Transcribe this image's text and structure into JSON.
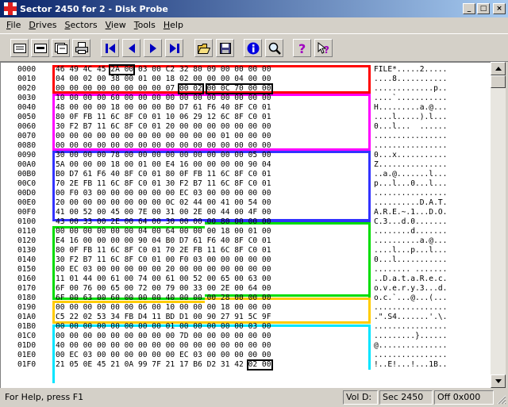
{
  "window": {
    "title": "Sector 2450 for 2 - Disk Probe",
    "minimize_glyph": "_",
    "maximize_glyph": "□",
    "close_glyph": "×"
  },
  "menu": [
    {
      "key": "F",
      "rest": "ile"
    },
    {
      "key": "D",
      "rest": "rives"
    },
    {
      "key": "S",
      "rest": "ectors"
    },
    {
      "key": "V",
      "rest": "iew"
    },
    {
      "key": "T",
      "rest": "ools"
    },
    {
      "key": "H",
      "rest": "elp"
    }
  ],
  "toolbar": {
    "icons": [
      "view-bytes-icon",
      "view-words-icon",
      "view-dwords-icon",
      "print-icon",
      "first-sector-icon",
      "previous-sector-icon",
      "next-sector-icon",
      "last-sector-icon",
      "open-icon",
      "save-icon",
      "info-icon",
      "find-icon",
      "help-icon",
      "context-help-icon"
    ]
  },
  "zone_colors": {
    "red": "#ff0000",
    "magenta": "#ff00ff",
    "blue": "#3333ff",
    "green": "#00dd00",
    "yellow": "#ffcc00",
    "cyan": "#00e5ff"
  },
  "dump": [
    {
      "offset": "0000",
      "hex": "46 49 4C 45 2A 00 03 00 C2 32 80 09 00 00 00 00",
      "ascii": "FILE*.....2....."
    },
    {
      "offset": "0010",
      "hex": "04 00 02 00 38 00 01 00 18 02 00 00 00 04 00 00",
      "ascii": "....8..........."
    },
    {
      "offset": "0020",
      "hex": "00 00 00 00 00 00 00 00 07 00 02 00 0C 70 00 00",
      "ascii": ".............p.."
    },
    {
      "offset": "0030",
      "hex": "10 00 00 00 60 00 00 00 00 00 00 00 00 00 00 00",
      "ascii": "....`..........."
    },
    {
      "offset": "0040",
      "hex": "48 00 00 00 18 00 00 00 B0 D7 61 F6 40 8F C0 01",
      "ascii": "H.........a.@..."
    },
    {
      "offset": "0050",
      "hex": "80 0F FB 11 6C 8F C0 01 10 06 29 12 6C 8F C0 01",
      "ascii": "....l.....).l..."
    },
    {
      "offset": "0060",
      "hex": "30 F2 B7 11 6C 8F C0 01 20 00 00 00 00 00 00 00",
      "ascii": "0...l...  ......"
    },
    {
      "offset": "0070",
      "hex": "00 00 00 00 00 00 00 00 00 00 00 00 01 00 00 00",
      "ascii": "................"
    },
    {
      "offset": "0080",
      "hex": "00 00 00 00 00 00 00 00 00 00 00 00 00 00 00 00",
      "ascii": "................"
    },
    {
      "offset": "0090",
      "hex": "30 00 00 00 78 00 00 00 00 00 00 00 00 00 05 00",
      "ascii": "0...x..........."
    },
    {
      "offset": "00A0",
      "hex": "5A 00 00 00 18 00 01 00 E4 16 00 00 00 00 90 04",
      "ascii": "Z..............."
    },
    {
      "offset": "00B0",
      "hex": "B0 D7 61 F6 40 8F C0 01 80 0F FB 11 6C 8F C0 01",
      "ascii": "..a.@.......l..."
    },
    {
      "offset": "00C0",
      "hex": "70 2E FB 11 6C 8F C0 01 30 F2 B7 11 6C 8F C0 01",
      "ascii": "p...l...0...l..."
    },
    {
      "offset": "00D0",
      "hex": "00 F0 03 00 00 00 00 00 00 EC 03 00 00 00 00 00",
      "ascii": "................"
    },
    {
      "offset": "00E0",
      "hex": "20 00 00 00 00 00 00 00 0C 02 44 00 41 00 54 00",
      "ascii": "..........D.A.T."
    },
    {
      "offset": "00F0",
      "hex": "41 00 52 00 45 00 7E 00 31 00 2E 00 44 00 4F 00",
      "ascii": "A.R.E.~.1...D.O."
    },
    {
      "offset": "0100",
      "hex": "43 00 33 00 2E 00 64 00 30 00 00 00 80 00 00 00",
      "ascii": "C.3...d.0......."
    },
    {
      "offset": "0110",
      "hex": "00 00 00 00 00 00 04 00 64 00 00 00 18 00 01 00",
      "ascii": "........d......."
    },
    {
      "offset": "0120",
      "hex": "E4 16 00 00 00 00 90 04 B0 D7 61 F6 40 8F C0 01",
      "ascii": "..........a.@..."
    },
    {
      "offset": "0130",
      "hex": "80 0F FB 11 6C 8F C0 01 70 2E FB 11 6C 8F C0 01",
      "ascii": "....l...p...l..."
    },
    {
      "offset": "0140",
      "hex": "30 F2 B7 11 6C 8F C0 01 00 F0 03 00 00 00 00 00",
      "ascii": "0...l..........."
    },
    {
      "offset": "0150",
      "hex": "00 EC 03 00 00 00 00 00 20 00 00 00 00 00 00 00",
      "ascii": "........ ......."
    },
    {
      "offset": "0160",
      "hex": "11 01 44 00 61 00 74 00 61 00 52 00 65 00 63 00",
      "ascii": "..D.a.t.a.R.e.c."
    },
    {
      "offset": "0170",
      "hex": "6F 00 76 00 65 00 72 00 79 00 33 00 2E 00 64 00",
      "ascii": "o.v.e.r.y.3...d."
    },
    {
      "offset": "0180",
      "hex": "6F 00 63 00 60 00 00 00 40 00 00 00 28 00 00 00",
      "ascii": "o.c.`...@...(..."
    },
    {
      "offset": "0190",
      "hex": "00 00 00 00 00 00 06 00 10 00 00 00 18 00 00 00",
      "ascii": "................"
    },
    {
      "offset": "01A0",
      "hex": "C5 22 02 53 34 FB D4 11 BD D1 00 90 27 91 5C 9F",
      "ascii": ".\".S4.......'.\\."
    },
    {
      "offset": "01B0",
      "hex": "00 00 00 00 00 00 00 00 01 00 00 00 00 00 03 00",
      "ascii": "................"
    },
    {
      "offset": "01C0",
      "hex": "00 00 00 00 00 00 00 00 00 7D 00 00 00 00 00 00",
      "ascii": ".........}......"
    },
    {
      "offset": "01D0",
      "hex": "40 00 00 00 00 00 00 00 00 00 00 00 00 00 00 00",
      "ascii": "@..............."
    },
    {
      "offset": "01E0",
      "hex": "00 EC 03 00 00 00 00 00 00 EC 03 00 00 00 00 00",
      "ascii": "................"
    },
    {
      "offset": "01F0",
      "hex": "21 05 0E 45 21 0A 99 7F 21 17 B6 D2 31 42 02 00",
      "ascii": "!..E!...!...1B.."
    }
  ],
  "status": {
    "help": "For Help, press F1",
    "volume": "Vol D:",
    "sector": "Sec 2450",
    "offset": "Off 0x000"
  }
}
